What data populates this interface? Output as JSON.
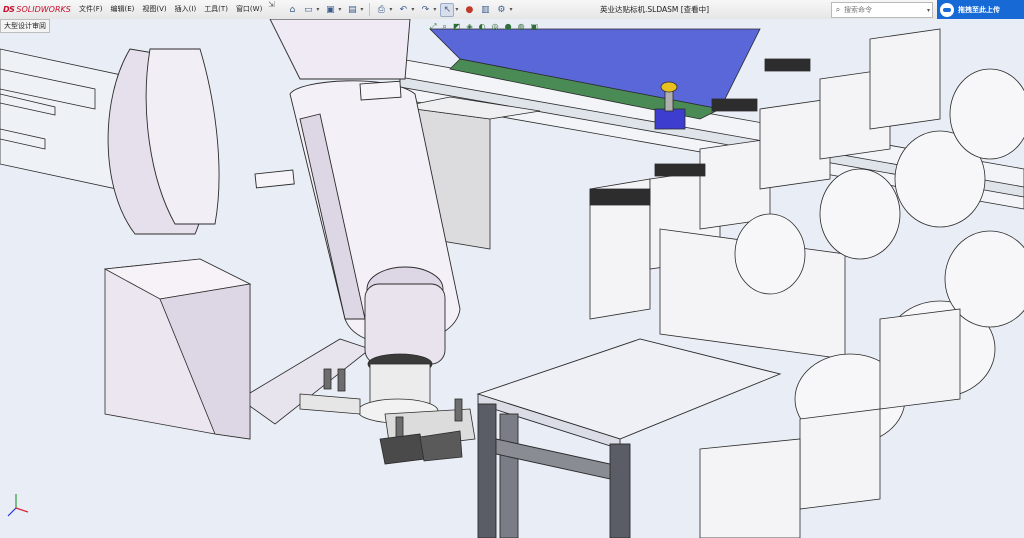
{
  "app": {
    "logo_prefix": "DS",
    "logo_name": "SOLIDWORKS"
  },
  "menu": [
    "文件(F)",
    "编辑(E)",
    "视图(V)",
    "插入(I)",
    "工具(T)",
    "窗口(W)"
  ],
  "window_title": "英业达贴标机.SLDASM [查看中]",
  "search": {
    "placeholder": "搜索命令"
  },
  "upload_button": "拖拽至此上传",
  "mode_label": "大型设计审阅",
  "colors": {
    "brand": "#c8102e",
    "upload": "#1769d6",
    "background": "#e9edf5",
    "conveyor": "#5a67d8"
  },
  "toolbar_icons": [
    "home-icon",
    "new-file-icon",
    "open-file-icon",
    "save-icon",
    "print-icon",
    "undo-icon",
    "redo-icon",
    "select-icon",
    "traffic-light-icon",
    "file-properties-icon",
    "options-gear-icon"
  ]
}
